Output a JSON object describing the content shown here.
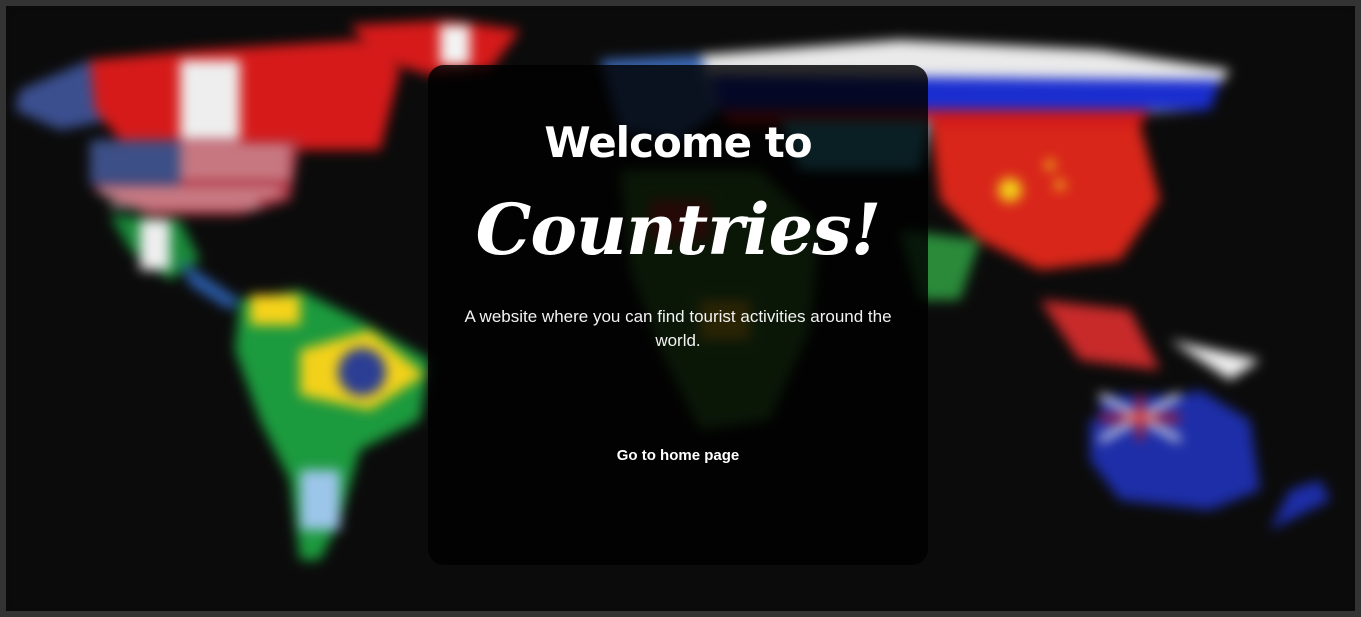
{
  "hero": {
    "welcome_text": "Welcome to",
    "brand_text": "Countries!",
    "tagline": "A website where you can find tourist activities around the world.",
    "cta_label": "Go to home page"
  },
  "colors": {
    "card_background": "#000000",
    "text": "#ffffff",
    "page_background": "#0a0a0a"
  },
  "background_image": "blurred-world-flag-map"
}
